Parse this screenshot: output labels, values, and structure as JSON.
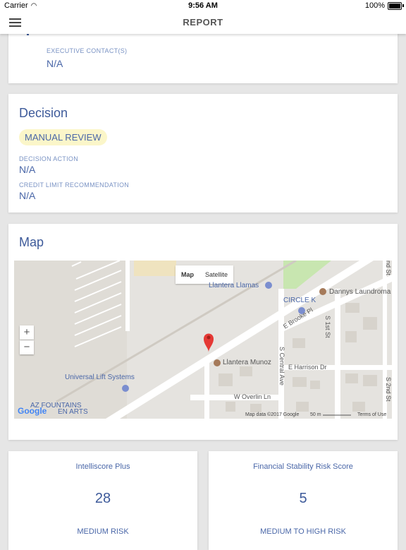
{
  "status": {
    "carrier": "Carrier",
    "time": "9:56 AM",
    "battery": "100%"
  },
  "nav": {
    "title": "REPORT"
  },
  "executive": {
    "label": "EXECUTIVE CONTACT(S)",
    "value": "N/A"
  },
  "decision": {
    "heading": "Decision",
    "badge": "MANUAL REVIEW",
    "action_label": "DECISION ACTION",
    "action_value": "N/A",
    "credit_label": "CREDIT LIMIT RECOMMENDATION",
    "credit_value": "N/A"
  },
  "map": {
    "heading": "Map",
    "type_map": "Map",
    "type_satellite": "Satellite",
    "zoom_in": "+",
    "zoom_out": "−",
    "places": {
      "llantera_llamas": "Llantera Llamas",
      "dannys": "Dannys Laundroma",
      "circle_k": "CIRCLE K",
      "universal": "Universal Lift Systems",
      "llantera_munoz": "Llantera Munoz",
      "az_fountains": "AZ FOUNTAINS",
      "garden_arts": "EN ARTS"
    },
    "streets": {
      "e_brooke": "E Brooke Pl",
      "s_1st": "S 1st St",
      "s_central": "S Central Ave",
      "e_harrison": "E Harrison Dr",
      "w_overlin": "W Overlin Ln",
      "s_2nd": "S 2nd St",
      "top_right": "nd St"
    },
    "google": "Google",
    "footer": {
      "data": "Map data ©2017 Google",
      "scale": "50 m",
      "terms": "Terms of Use"
    }
  },
  "scores": [
    {
      "title": "Intelliscore Plus",
      "value": "28",
      "risk": "MEDIUM RISK"
    },
    {
      "title": "Financial Stability Risk Score",
      "value": "5",
      "risk": "MEDIUM TO HIGH RISK"
    }
  ],
  "colors": {
    "accent": "#4a67a8",
    "badge_bg": "#fbf6c9",
    "pin": "#e53935"
  }
}
